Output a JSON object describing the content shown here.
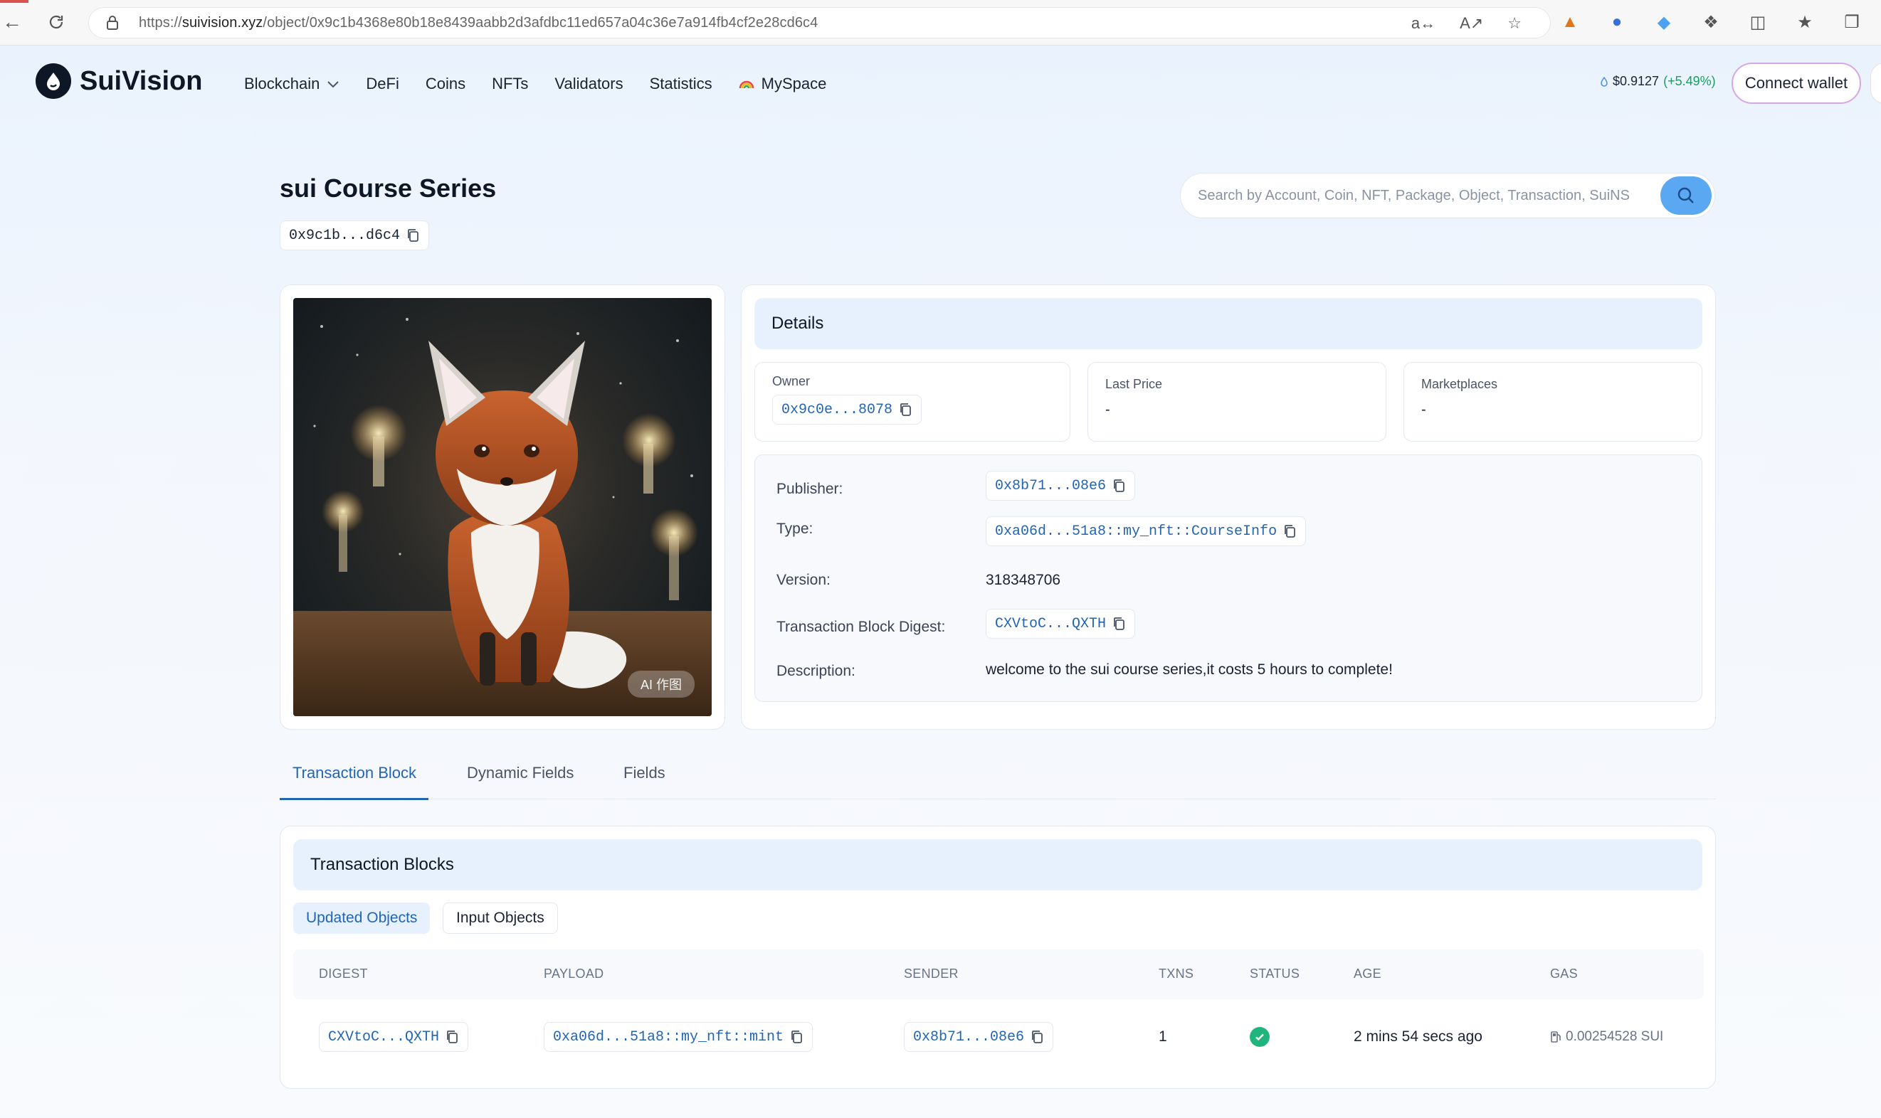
{
  "browser": {
    "url_prefix": "https://",
    "url_domain": "suivision.xyz",
    "url_path": "/object/0x9c1b4368e80b18e8439aabb2d3afdbc11ed657a04c36e7a914fb4cf2e28cd6c4"
  },
  "header": {
    "logo_text": "SuiVision",
    "nav": [
      "Blockchain",
      "DeFi",
      "Coins",
      "NFTs",
      "Validators",
      "Statistics",
      "MySpace"
    ],
    "price": "$0.9127",
    "price_change": "(+5.49%)",
    "connect_label": "Connect wallet"
  },
  "object": {
    "title": "sui Course Series",
    "address_short": "0x9c1b...d6c4",
    "ai_badge": "AI 作图"
  },
  "search": {
    "placeholder": "Search by Account, Coin, NFT, Package, Object, Transaction, SuiNS"
  },
  "details": {
    "heading": "Details",
    "owner_label": "Owner",
    "owner_value": "0x9c0e...8078",
    "last_price_label": "Last Price",
    "last_price_value": "-",
    "marketplaces_label": "Marketplaces",
    "marketplaces_value": "-",
    "publisher_label": "Publisher:",
    "publisher_value": "0x8b71...08e6",
    "type_label": "Type:",
    "type_value": "0xa06d...51a8::my_nft::CourseInfo",
    "version_label": "Version:",
    "version_value": "318348706",
    "digest_label": "Transaction Block Digest:",
    "digest_value": "CXVtoC...QXTH",
    "description_label": "Description:",
    "description_value": "welcome to the sui course series,it costs 5 hours to complete!"
  },
  "tabs": [
    "Transaction Block",
    "Dynamic Fields",
    "Fields"
  ],
  "tx": {
    "heading": "Transaction Blocks",
    "segment_on": "Updated Objects",
    "segment_off": "Input Objects",
    "columns": [
      "DIGEST",
      "PAYLOAD",
      "SENDER",
      "TXNS",
      "STATUS",
      "AGE",
      "GAS"
    ],
    "rows": [
      {
        "digest": "CXVtoC...QXTH",
        "payload": "0xa06d...51a8::my_nft::mint",
        "sender": "0x8b71...08e6",
        "txns": "1",
        "status": "success",
        "age": "2 mins 54 secs ago",
        "gas": "0.00254528 SUI"
      }
    ]
  },
  "colors": {
    "accent": "#2265b5",
    "success": "#1fb57c",
    "panel_head": "#e6f1fd"
  }
}
